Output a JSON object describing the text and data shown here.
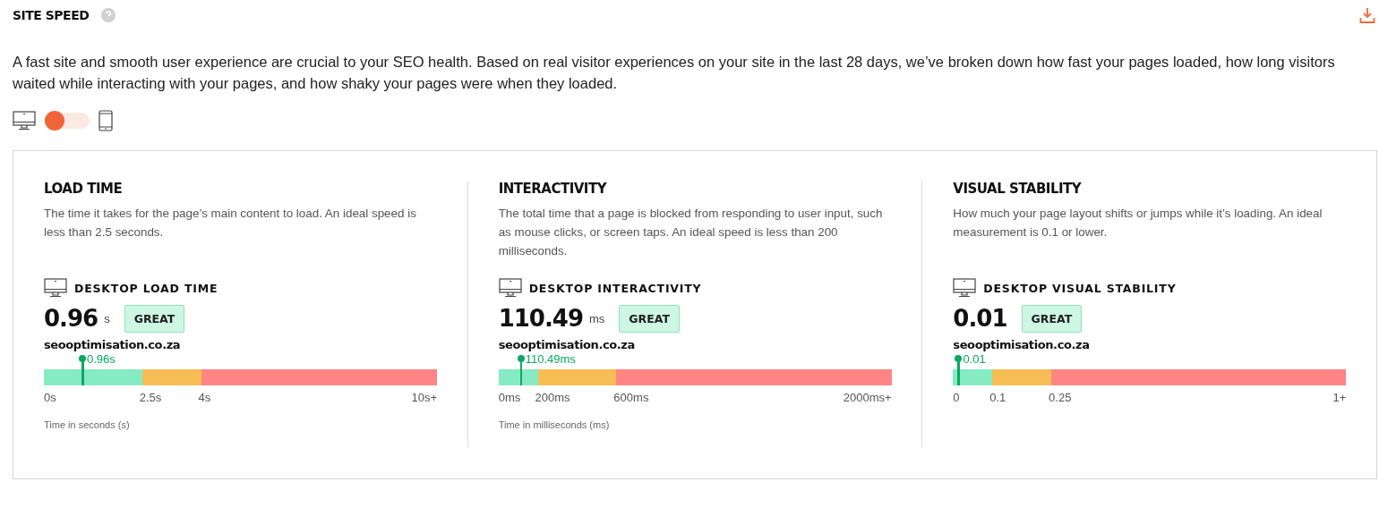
{
  "header": {
    "title": "SITE SPEED"
  },
  "intro": "A fast site and smooth user experience are crucial to your SEO health. Based on real visitor experiences on your site in the last 28 days, we’ve broken down how fast your pages loaded, how long visitors waited while interacting with your pages, and how shaky your pages were when they loaded.",
  "device_toggle": {
    "mobile": false
  },
  "metrics": [
    {
      "title": "LOAD TIME",
      "description": "The time it takes for the page’s main content to load. An ideal speed is less than 2.5 seconds.",
      "device_label": "DESKTOP LOAD TIME",
      "value": "0.96",
      "unit": "s",
      "rating": "GREAT",
      "site": "seooptimisation.co.za",
      "marker_label": "0.96s",
      "segments": [
        {
          "color": "#86ebc2"
        },
        {
          "color": "#f6bd55"
        },
        {
          "color": "#ff8585"
        }
      ],
      "ticks": [
        "0s",
        "2.5s",
        "4s",
        "10s+"
      ],
      "footnote": "Time in seconds (s)"
    },
    {
      "title": "INTERACTIVITY",
      "description": "The total time that a page is blocked from responding to user input, such as mouse clicks, or screen taps. An ideal speed is less than 200 milliseconds.",
      "device_label": "DESKTOP INTERACTIVITY",
      "value": "110.49",
      "unit": "ms",
      "rating": "GREAT",
      "site": "seooptimisation.co.za",
      "marker_label": "110.49ms",
      "segments": [
        {
          "color": "#86ebc2"
        },
        {
          "color": "#f6bd55"
        },
        {
          "color": "#ff8585"
        }
      ],
      "ticks": [
        "0ms",
        "200ms",
        "600ms",
        "2000ms+"
      ],
      "footnote": "Time in milliseconds (ms)"
    },
    {
      "title": "VISUAL STABILITY",
      "description": "How much your page layout shifts or jumps while it’s loading. An ideal measurement is 0.1 or lower.",
      "device_label": "DESKTOP VISUAL STABILITY",
      "value": "0.01",
      "rating": "GREAT",
      "site": "seooptimisation.co.za",
      "marker_label": "0.01",
      "segments": [
        {
          "color": "#86ebc2"
        },
        {
          "color": "#f6bd55"
        },
        {
          "color": "#ff8585"
        }
      ],
      "ticks": [
        "0",
        "0.1",
        "0.25",
        "1+"
      ]
    }
  ]
}
